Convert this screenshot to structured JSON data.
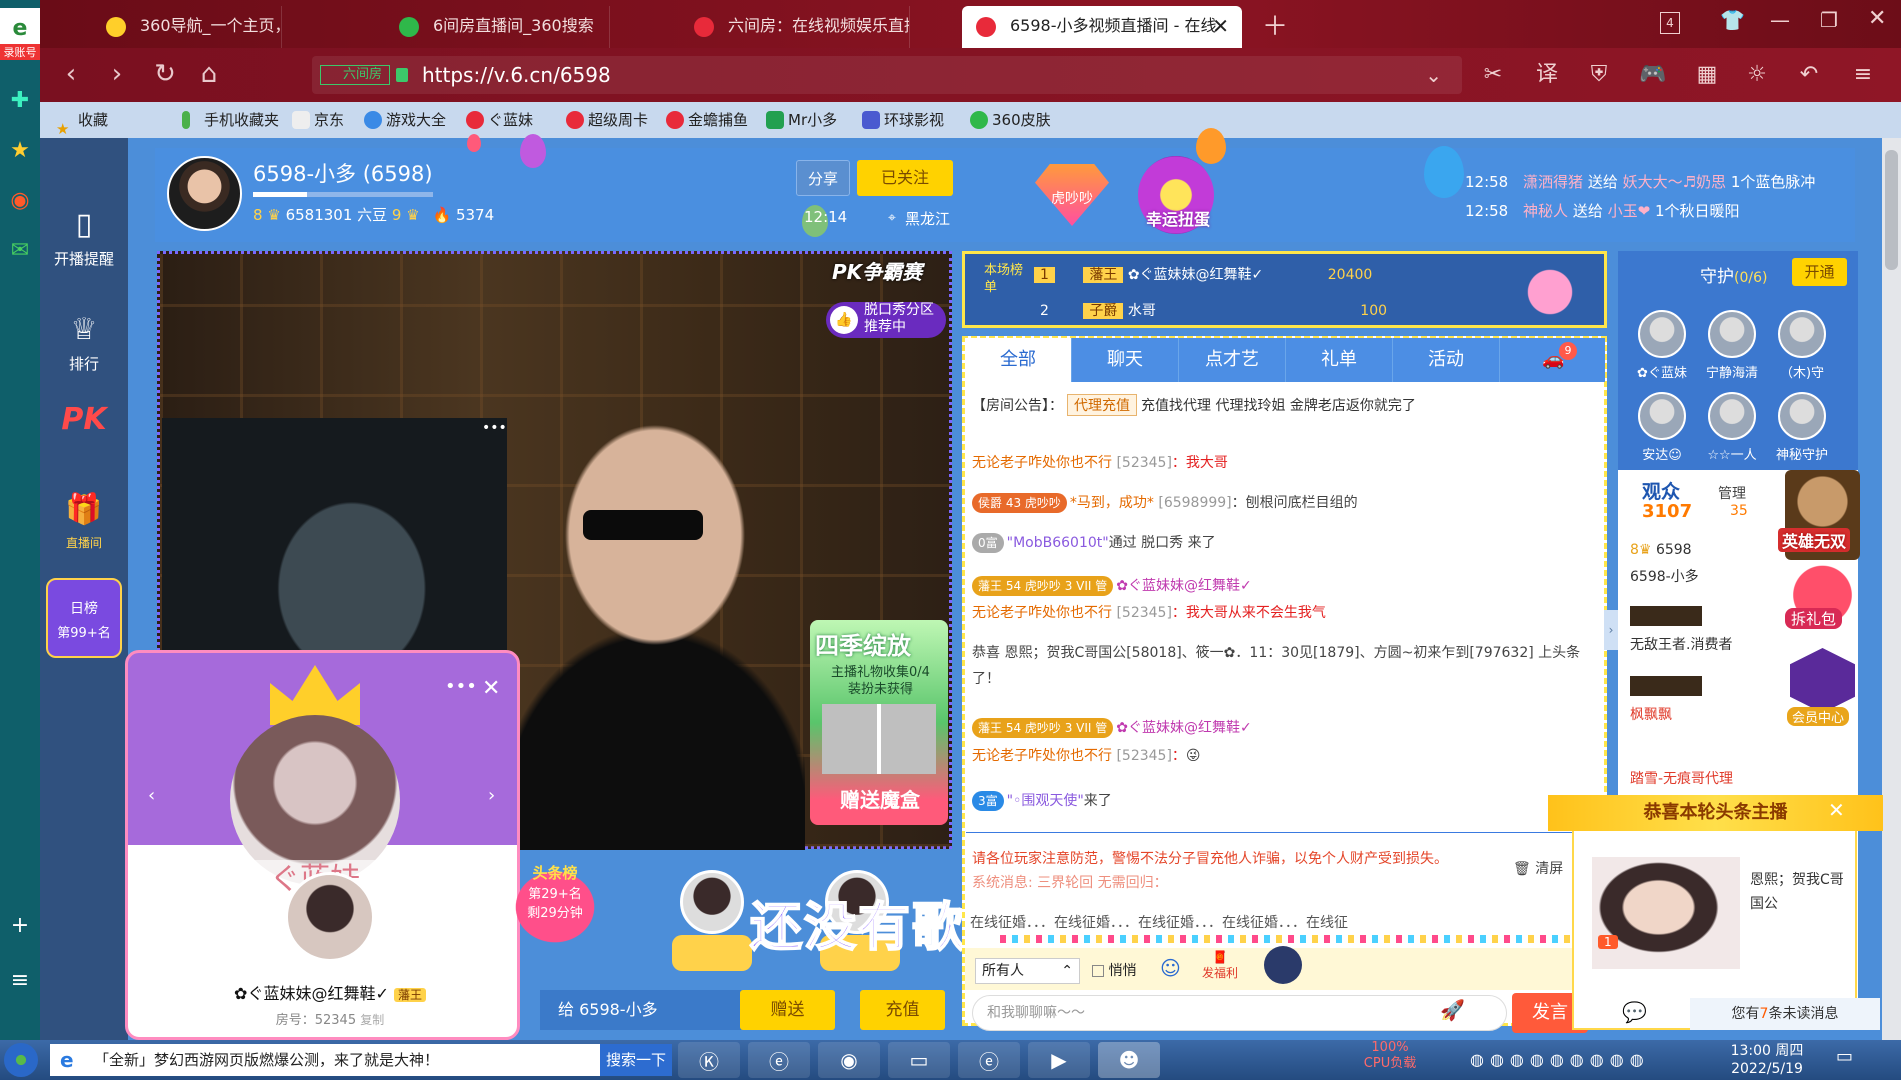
{
  "tabs": [
    {
      "label": "360导航_一个主页，整个世界"
    },
    {
      "label": "6间房直播间_360搜索"
    },
    {
      "label": "六间房：在线视频娱乐直播平台"
    },
    {
      "label": "6598-小多视频直播间 - 在线"
    }
  ],
  "tab_count": "4",
  "address": {
    "url": "https://v.6.cn/6598",
    "brand": "六间房"
  },
  "bookmarks": [
    "收藏",
    "手机收藏夹",
    "京东",
    "游戏大全",
    "ぐ蓝妹",
    "超级周卡",
    "金蟾捕鱼",
    "Mr小多",
    "环球影视",
    "360皮肤"
  ],
  "os_sidebar": {
    "top_label": "录账号"
  },
  "left_nav": [
    {
      "label": "开播提醒",
      "icon": "phone-icon"
    },
    {
      "label": "排行",
      "icon": "crown-icon"
    },
    {
      "label": "PK",
      "icon": "pk-icon"
    },
    {
      "label": "直播间",
      "icon": "gift-box-icon"
    },
    {
      "label": "日榜",
      "icon": "daily-rank-icon"
    },
    {
      "label": "第99+名",
      "icon": ""
    }
  ],
  "header": {
    "anchor_name": "6598-小多 (6598)",
    "level_a": "8",
    "beans": "6581301 六豆",
    "level_b": "9",
    "fire": "5374",
    "share": "分享",
    "follow": "已关注",
    "time": "12:14",
    "location": "黑龙江",
    "badge": "虎吵吵",
    "lucky": "幸运扭蛋"
  },
  "gift_messages": [
    {
      "time": "12:58",
      "user": "潇洒得猪",
      "action": "送给",
      "target": "妖大大～♬奶思",
      "item": "1个蓝色脉冲"
    },
    {
      "time": "12:58",
      "user": "神秘人",
      "action": "送给",
      "target": "小玉❤",
      "item": "1个秋日暖阳"
    }
  ],
  "video": {
    "pk_tag": "PK争霸赛",
    "recommend": "脱口秀分区 推荐中",
    "season_title": "四季绽放",
    "season_sub": "主播礼物收集0/4 装扮未获得",
    "season_btn": "赠送魔盒"
  },
  "fan_card": {
    "name": "✿ぐ蓝妹妹@红舞鞋✓",
    "tag": "藩王",
    "room": "房号：52345",
    "copy": "复制",
    "banner": "ぐ蓝妹"
  },
  "headline": {
    "title": "头条榜",
    "rank": "第29+名",
    "remain": "剩29分钟"
  },
  "lyrics": "还没有歌词哦",
  "bottom_bar": {
    "to": "给 6598-小多",
    "send": "赠送",
    "pay": "充值"
  },
  "ranking": {
    "title": "本场榜单",
    "rows": [
      {
        "rank": "1",
        "tag": "藩王",
        "name": "✿ぐ蓝妹妹@红舞鞋✓",
        "coins": "20400"
      },
      {
        "rank": "2",
        "tag": "子爵",
        "name": "水哥",
        "coins": "100"
      }
    ]
  },
  "chat_tabs": [
    "全部",
    "聊天",
    "点才艺",
    "礼单",
    "活动",
    "9"
  ],
  "notice": {
    "label": "【房间公告】：",
    "tag": "代理充值",
    "text": "充值找代理 代理找玲姐 金牌老店返你就完了"
  },
  "chat": [
    {
      "user": "无论老子咋处你也不行",
      "id": "[52345]",
      "msg": "：我大哥"
    },
    {
      "badges": "侯爵 43 虎吵吵",
      "user": "*马到，成功*",
      "id": "[6598999]",
      "msg": "：刨根问底栏目组的"
    },
    {
      "badges": "0富",
      "user": "\"MobB66010t\"",
      "msg": "通过 脱口秀 来了"
    },
    {
      "badges": "藩王 54 虎吵吵 3 VII 管",
      "user": "✿ぐ蓝妹妹@红舞鞋✓"
    },
    {
      "user": "无论老子咋处你也不行",
      "id": "[52345]",
      "msg": "：我大哥从来不会生我气"
    },
    {
      "msg": "恭喜 恩熙；贺我C哥国公[58018]、筱一✿．11：30见[1879]、方圆~初来乍到[797632] 上头条了！"
    },
    {
      "badges": "藩王 54 虎吵吵 3 VII 管",
      "user": "✿ぐ蓝妹妹@红舞鞋✓"
    },
    {
      "user": "无论老子咋处你也不行",
      "id": "[52345]",
      "msg": "："
    },
    {
      "badges": "3富",
      "user": "\"◦围观天使\"",
      "msg": "来了"
    }
  ],
  "warning": "请各位玩家注意防范，警惕不法分子冒充他人诈骗，以免个人财产受到损失。",
  "system_msg": "系统消息: 三界轮回 无需回归：",
  "public_row": "在线征婚．．．在线征婚．．．在线征婚．．．在线征婚．．．在线征",
  "clear": "清屏",
  "chat_toolbar": {
    "target": "所有人",
    "quiet": "悄悄",
    "fafuli": "发福利"
  },
  "chat_input_placeholder": "和我聊聊嘛～～",
  "chat_send": "发言",
  "guard": {
    "title": "守护",
    "count": "(0/6)",
    "open": "开通",
    "members": [
      "✿ぐ蓝妹",
      "宁静海清",
      "（木)守",
      "安达☺",
      "☆☆一人",
      "神秘守护"
    ]
  },
  "audience": {
    "label": "观众",
    "count": "3107",
    "manager_label": "管理",
    "manager_count": "35",
    "rows": [
      {
        "level": "8",
        "name": "6598"
      },
      {
        "name": "6598-小多"
      },
      {
        "name": "无敌王者.消费者"
      },
      {
        "name": "枫飘飘"
      },
      {
        "name": "踏雪-无痕哥代理"
      }
    ]
  },
  "promos": {
    "hero": "英雄无双",
    "gift": "拆礼包",
    "member": "会员中心"
  },
  "headline_popup": {
    "title": "恭喜本轮头条主播",
    "text": "恩熙；贺我C哥国公",
    "rank": "1"
  },
  "unread": {
    "prefix": "您有",
    "count": "7",
    "suffix": "条未读消息"
  },
  "taskbar": {
    "notification": "「全新」梦幻西游网页版燃爆公测，来了就是大神！",
    "search": "搜索一下",
    "cpu_value": "100%",
    "cpu_label": "CPU负载",
    "time": "13:00 周四",
    "date": "2022/5/19"
  }
}
